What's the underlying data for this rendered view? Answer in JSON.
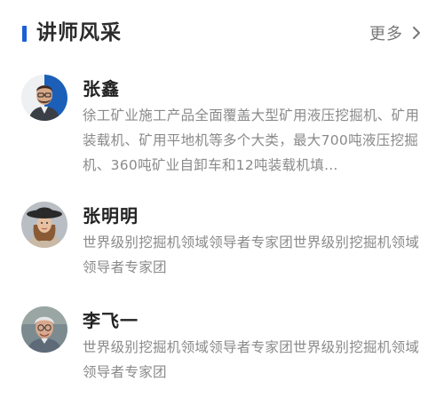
{
  "section": {
    "title": "讲师风采",
    "more_label": "更多",
    "accent_color": "#1a5fd6"
  },
  "instructors": [
    {
      "name": "张鑫",
      "desc": "徐工矿业施工产品全面覆盖大型矿用液压挖掘机、矿用装载机、矿用平地机等多个大类，最大700吨液压挖掘机、360吨矿业自卸车和12吨装载机填…",
      "avatar_icon": "man-with-glasses-portrait"
    },
    {
      "name": "张明明",
      "desc": "世界级别挖掘机领域领导者专家团世界级别挖掘机领域领导者专家团",
      "avatar_icon": "woman-with-hat-portrait"
    },
    {
      "name": "李飞一",
      "desc": "世界级别挖掘机领域领导者专家团世界级别挖掘机领域领导者专家团",
      "avatar_icon": "older-man-portrait"
    }
  ]
}
